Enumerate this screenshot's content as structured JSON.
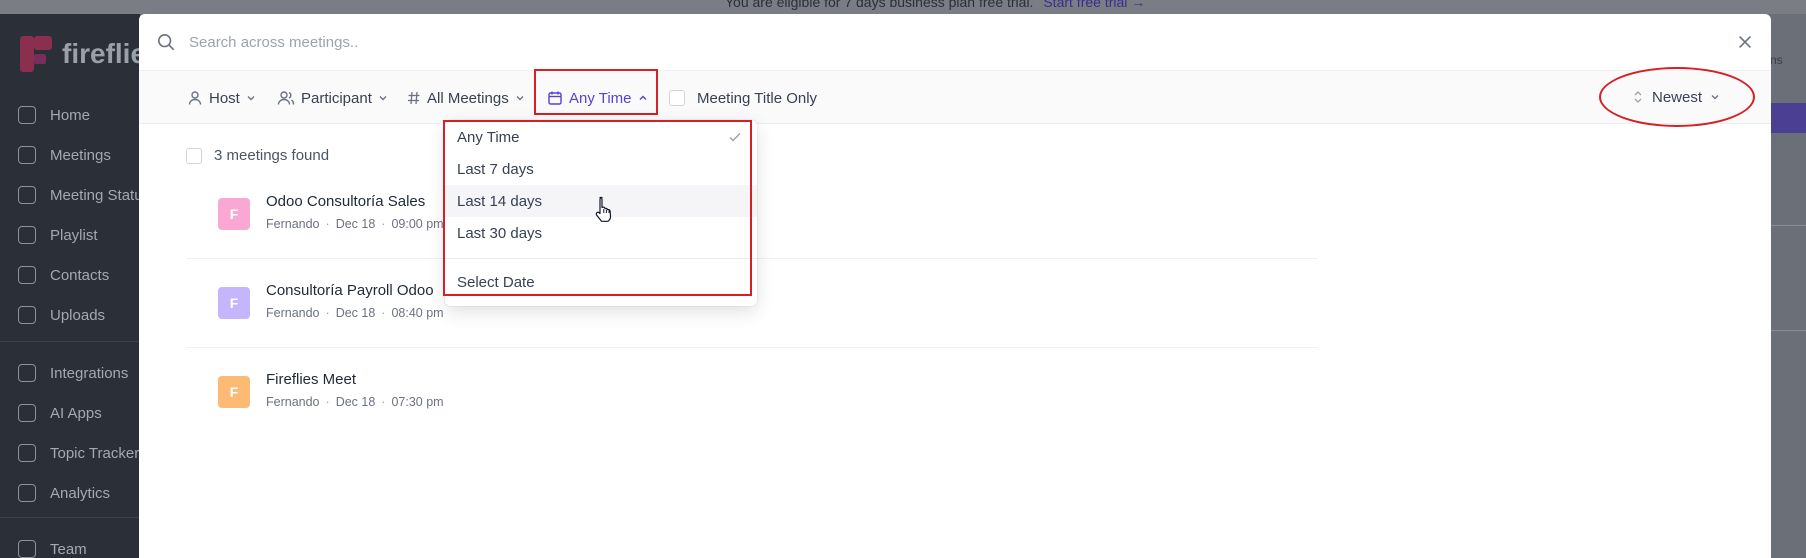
{
  "background": {
    "banner_text": "You are eligible for 7 days business plan free trial.",
    "banner_link": "Start free trial",
    "logo_text": "fireflies",
    "right_text": "ns",
    "nav": [
      {
        "label": "Home",
        "icon": "home-icon"
      },
      {
        "label": "Meetings",
        "icon": "video-icon"
      },
      {
        "label": "Meeting Status",
        "icon": "bolt-icon"
      },
      {
        "label": "Playlist",
        "icon": "playlist-icon"
      },
      {
        "label": "Contacts",
        "icon": "contacts-icon"
      },
      {
        "label": "Uploads",
        "icon": "upload-icon"
      },
      {
        "label": "Integrations",
        "icon": "layers-icon"
      },
      {
        "label": "AI Apps",
        "icon": "sparkle-icon"
      },
      {
        "label": "Topic Trackers",
        "icon": "hash-icon"
      },
      {
        "label": "Analytics",
        "icon": "chart-icon"
      },
      {
        "label": "Team",
        "icon": "team-icon"
      }
    ]
  },
  "search": {
    "placeholder": "Search across meetings.."
  },
  "filters": {
    "host": "Host",
    "participant": "Participant",
    "all_meetings": "All Meetings",
    "any_time": "Any Time",
    "title_only": "Meeting Title Only",
    "sort": "Newest"
  },
  "results": {
    "count_text": "3 meetings found",
    "meetings": [
      {
        "avatar": "F",
        "color": "#f9a8d4",
        "title": "Odoo Consultoría Sales",
        "host": "Fernando",
        "date": "Dec 18",
        "time": "09:00 pm"
      },
      {
        "avatar": "F",
        "color": "#c4b5fd",
        "title": "Consultoría Payroll Odoo",
        "host": "Fernando",
        "date": "Dec 18",
        "time": "08:40 pm"
      },
      {
        "avatar": "F",
        "color": "#fdba74",
        "title": "Fireflies Meet",
        "host": "Fernando",
        "date": "Dec 18",
        "time": "07:30 pm"
      }
    ]
  },
  "dropdown": {
    "options": [
      "Any Time",
      "Last 7 days",
      "Last 14 days",
      "Last 30 days"
    ],
    "select_date": "Select Date",
    "selected": "Any Time",
    "hovered": "Last 14 days"
  },
  "colors": {
    "accent": "#5b3fd0",
    "highlight": "#d61f26"
  }
}
